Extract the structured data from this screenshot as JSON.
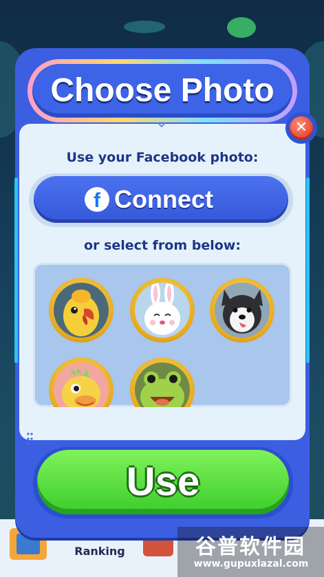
{
  "popup": {
    "title": "Choose Photo",
    "facebook_prompt": "Use your Facebook photo:",
    "connect_label": "Connect",
    "select_prompt": "or select from below:",
    "confirm_label": "Use",
    "close_icon": "close-icon"
  },
  "avatars": [
    {
      "name": "parrot-avatar",
      "selected": false
    },
    {
      "name": "bunny-avatar",
      "selected": false
    },
    {
      "name": "husky-avatar",
      "selected": false
    },
    {
      "name": "dragon-avatar",
      "selected": false
    },
    {
      "name": "frog-avatar",
      "selected": false
    }
  ],
  "bottom_nav": {
    "ranking_label": "Ranking"
  },
  "watermark": {
    "brand": "谷普软件园",
    "url": "www.gupuxlazal.com"
  },
  "colors": {
    "panel_blue": "#3b5fe0",
    "connect_blue": "#3557d8",
    "use_green": "#3ccc2c",
    "close_red": "#e8452f",
    "label_navy": "#1d3685"
  }
}
